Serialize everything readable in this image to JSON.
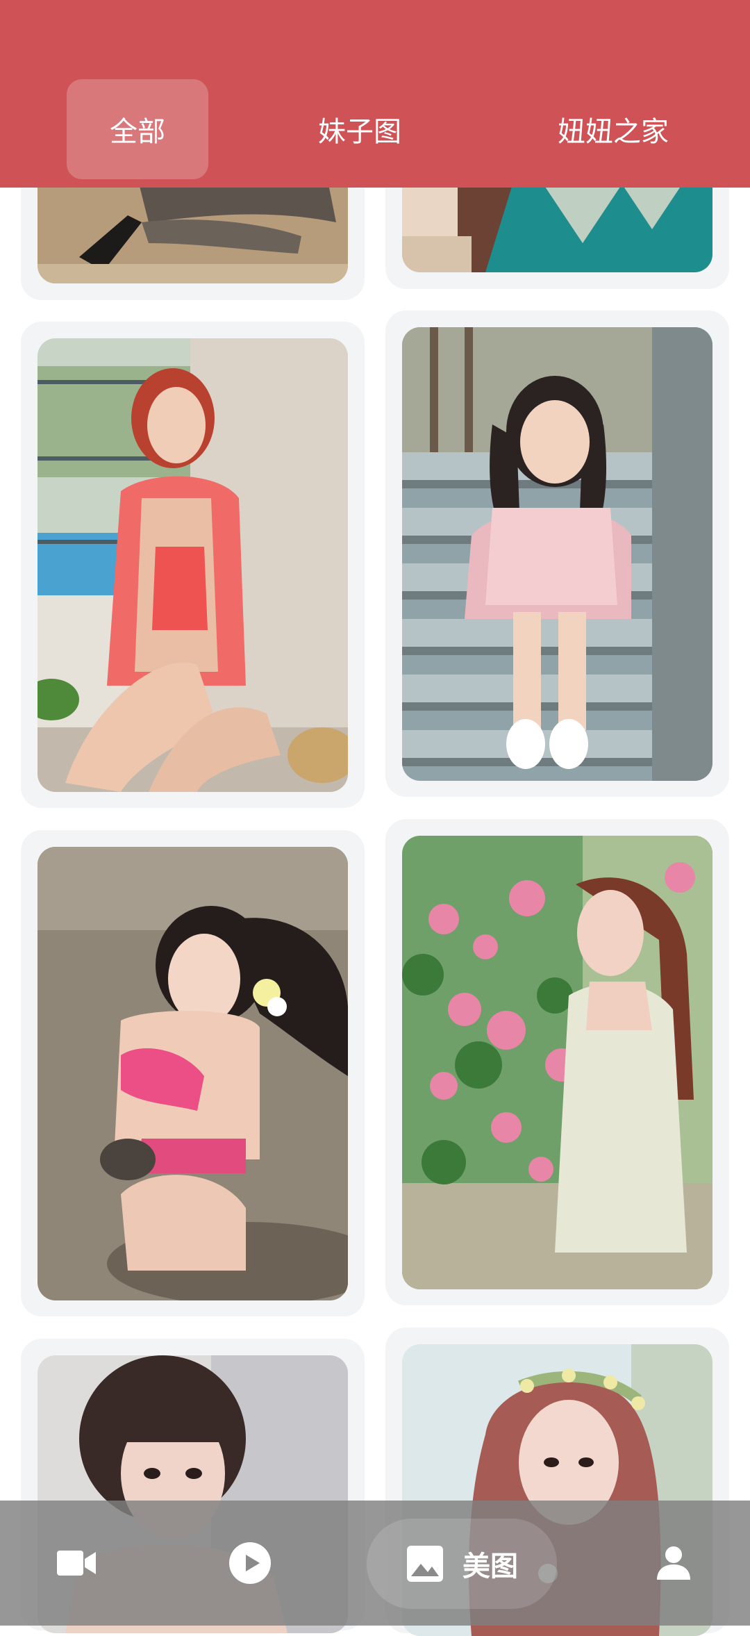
{
  "header": {
    "tabs": [
      {
        "label": "全部",
        "active": true
      },
      {
        "label": "妹子图",
        "active": false
      },
      {
        "label": "妞妞之家",
        "active": false
      }
    ],
    "background_color": "#cf5356"
  },
  "bottom_nav": {
    "items": [
      {
        "icon": "video-camera-icon"
      },
      {
        "icon": "play-circle-icon"
      },
      {
        "icon": "image-icon",
        "label": "美图",
        "selected": true
      },
      {
        "icon": "person-icon"
      }
    ]
  },
  "grid": {
    "photos": [
      {
        "subject": "legs-high-heels-sofa"
      },
      {
        "subject": "teal-patterned-bag"
      },
      {
        "subject": "woman-red-swimsuit-balcony"
      },
      {
        "subject": "girl-pigtails-floral-dress-stairs"
      },
      {
        "subject": "woman-pink-bikini-beach"
      },
      {
        "subject": "woman-white-dress-pink-flowers"
      },
      {
        "subject": "woman-bangs-portrait"
      },
      {
        "subject": "girl-flower-crown-portrait"
      }
    ]
  }
}
